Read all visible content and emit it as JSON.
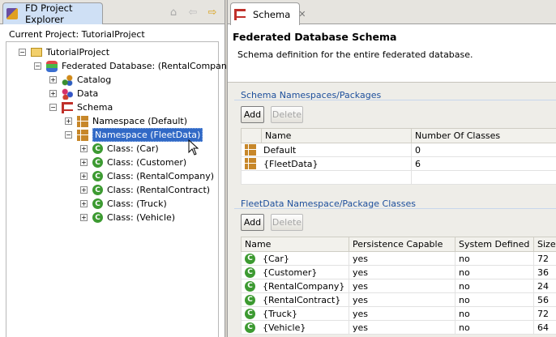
{
  "explorer": {
    "tab_title": "FD Project Explorer",
    "current_project_label": "Current Project: TutorialProject",
    "tree": {
      "project": "TutorialProject",
      "federated": "Federated Database: (RentalCompany)",
      "catalog": "Catalog",
      "data": "Data",
      "schema": "Schema",
      "ns_default": "Namespace (Default)",
      "ns_fleet": "Namespace (FleetData)",
      "classes": [
        "Class: (Car)",
        "Class: (Customer)",
        "Class: (RentalCompany)",
        "Class: (RentalContract)",
        "Class: (Truck)",
        "Class: (Vehicle)"
      ]
    }
  },
  "editor": {
    "tab_title": "Schema",
    "title": "Federated Database Schema",
    "subtitle": "Schema definition for the entire federated database.",
    "namespaces": {
      "section_title": "Schema Namespaces/Packages",
      "add_label": "Add",
      "delete_label": "Delete",
      "columns": [
        "Name",
        "Number Of Classes"
      ],
      "rows": [
        {
          "name": "Default",
          "count": "0"
        },
        {
          "name": "{FleetData}",
          "count": "6"
        }
      ]
    },
    "classes": {
      "section_title": "FleetData Namespace/Package Classes",
      "add_label": "Add",
      "delete_label": "Delete",
      "columns": [
        "Name",
        "Persistence Capable",
        "System Defined",
        "Size"
      ],
      "rows": [
        {
          "name": "{Car}",
          "pc": "yes",
          "sys": "no",
          "size": "72"
        },
        {
          "name": "{Customer}",
          "pc": "yes",
          "sys": "no",
          "size": "36"
        },
        {
          "name": "{RentalCompany}",
          "pc": "yes",
          "sys": "no",
          "size": "24"
        },
        {
          "name": "{RentalContract}",
          "pc": "yes",
          "sys": "no",
          "size": "56"
        },
        {
          "name": "{Truck}",
          "pc": "yes",
          "sys": "no",
          "size": "72"
        },
        {
          "name": "{Vehicle}",
          "pc": "yes",
          "sys": "no",
          "size": "64"
        }
      ]
    }
  }
}
